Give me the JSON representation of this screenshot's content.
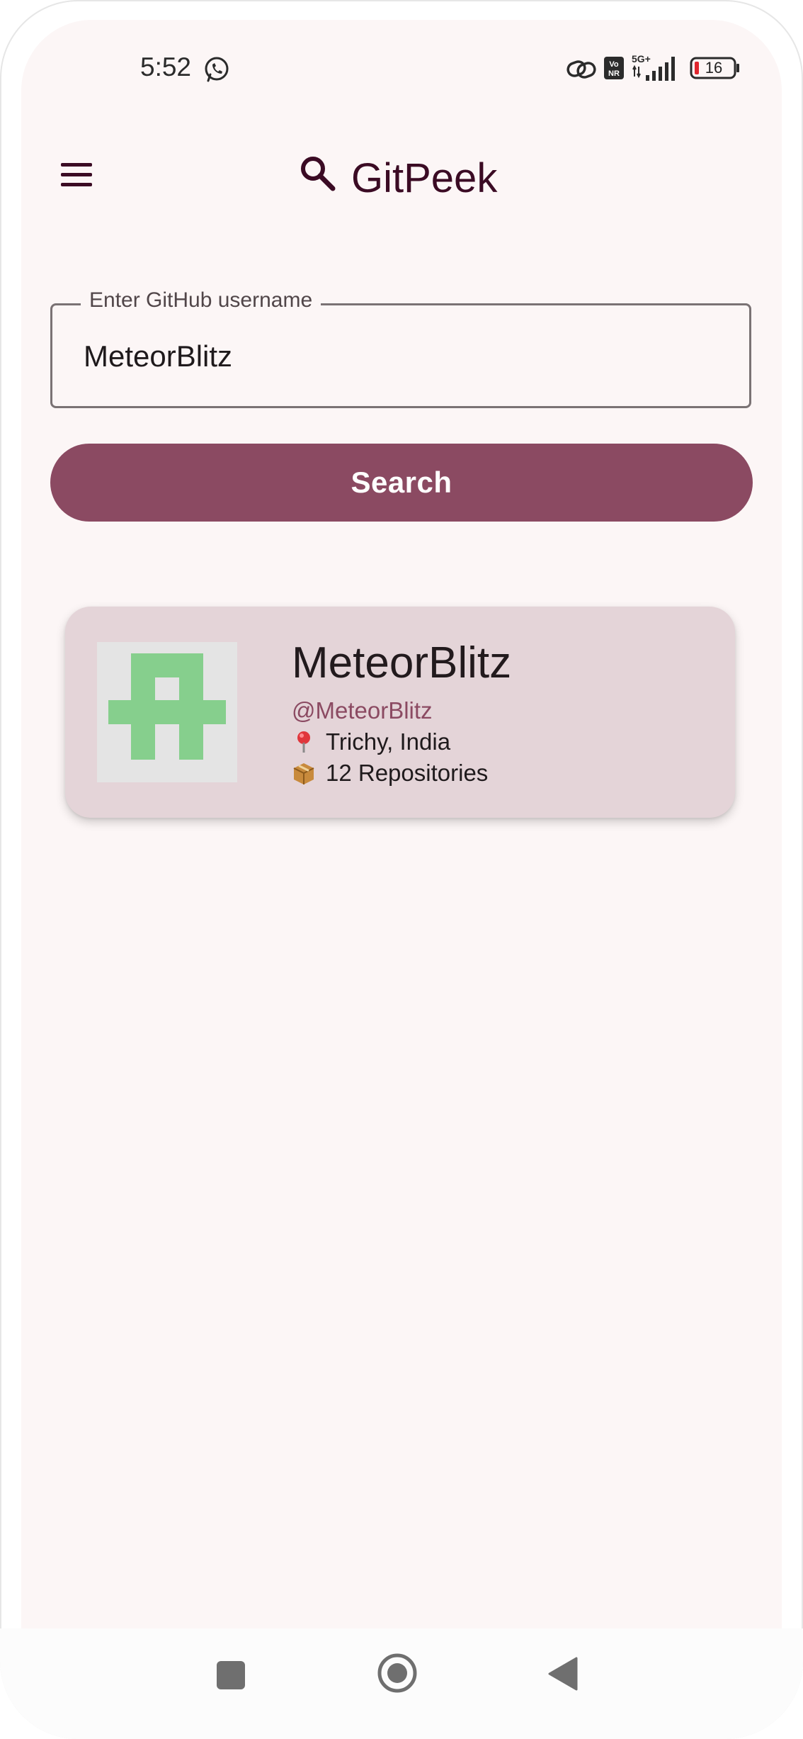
{
  "status_bar": {
    "time": "5:52",
    "battery_level": "16",
    "icons": [
      "whatsapp-icon",
      "link-icon",
      "vonr-icon",
      "5g-signal-icon",
      "battery-icon"
    ]
  },
  "app_bar": {
    "title": "GitPeek",
    "menu_icon": "hamburger-menu-icon",
    "title_icon": "search-icon"
  },
  "search": {
    "label": "Enter GitHub username",
    "value": "MeteorBlitz",
    "button_label": "Search"
  },
  "user_card": {
    "name": "MeteorBlitz",
    "handle": "@MeteorBlitz",
    "location": "Trichy, India",
    "repositories": "12 Repositories",
    "location_icon": "pin-icon",
    "repo_icon": "package-icon"
  },
  "nav_bar": {
    "icons": [
      "recents-square-icon",
      "home-circle-icon",
      "back-triangle-icon"
    ]
  },
  "colors": {
    "background": "#fcf6f6",
    "primary": "#8b4a62",
    "card": "#e4d4d8",
    "title": "#3b0b24",
    "avatar_green": "#86cf8d"
  }
}
